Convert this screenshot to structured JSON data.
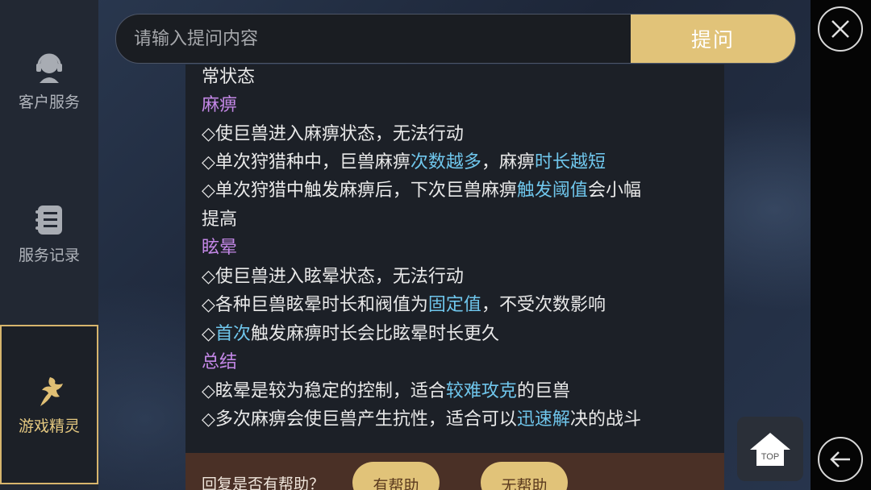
{
  "sidebar": {
    "items": [
      {
        "label": "客户服务",
        "icon": "customer-service-icon"
      },
      {
        "label": "服务记录",
        "icon": "service-record-icon"
      },
      {
        "label": "游戏精灵",
        "icon": "game-sprite-icon",
        "active": true
      }
    ]
  },
  "search": {
    "placeholder": "请输入提问内容",
    "button_label": "提问"
  },
  "content": {
    "lines": [
      {
        "type": "text",
        "parts": [
          "常状态"
        ]
      },
      {
        "type": "heading",
        "parts": [
          "麻痹"
        ]
      },
      {
        "type": "text",
        "parts": [
          "◇使巨兽进入麻痹状态，无法行动"
        ]
      },
      {
        "type": "text",
        "parts": [
          "◇单次狩猎种中，巨兽麻痹",
          "次数越多",
          "，麻痹",
          "时长越短"
        ]
      },
      {
        "type": "text",
        "parts": [
          "◇单次狩猎中触发麻痹后，下次巨兽麻痹",
          "触发阈值",
          "会小幅"
        ]
      },
      {
        "type": "text",
        "parts": [
          "提高"
        ]
      },
      {
        "type": "heading",
        "parts": [
          "眩晕"
        ]
      },
      {
        "type": "text",
        "parts": [
          "◇使巨兽进入眩晕状态，无法行动"
        ]
      },
      {
        "type": "text",
        "parts": [
          "◇各种巨兽眩晕时长和阀值为",
          "固定值",
          "，不受次数影响"
        ]
      },
      {
        "type": "text",
        "parts": [
          "◇",
          "首次",
          "触发麻痹时长会比眩晕时长更久"
        ]
      },
      {
        "type": "heading",
        "parts": [
          "总结"
        ]
      },
      {
        "type": "text",
        "parts": [
          "◇眩晕是较为稳定的控制，适合",
          "较难攻克",
          "的巨兽"
        ]
      },
      {
        "type": "text",
        "parts": [
          "◇多次麻痹会使巨兽产生抗性，适合可以",
          "迅速解",
          "决的战斗"
        ]
      }
    ]
  },
  "feedback": {
    "question": "回复是否有帮助？",
    "helpful_label": "有帮助",
    "unhelpful_label": "无帮助"
  },
  "top_button": {
    "label": "TOP"
  },
  "colors": {
    "accent_gold": "#e1c379",
    "heading_purple": "#c387e6",
    "highlight_blue": "#6fc6ec"
  }
}
